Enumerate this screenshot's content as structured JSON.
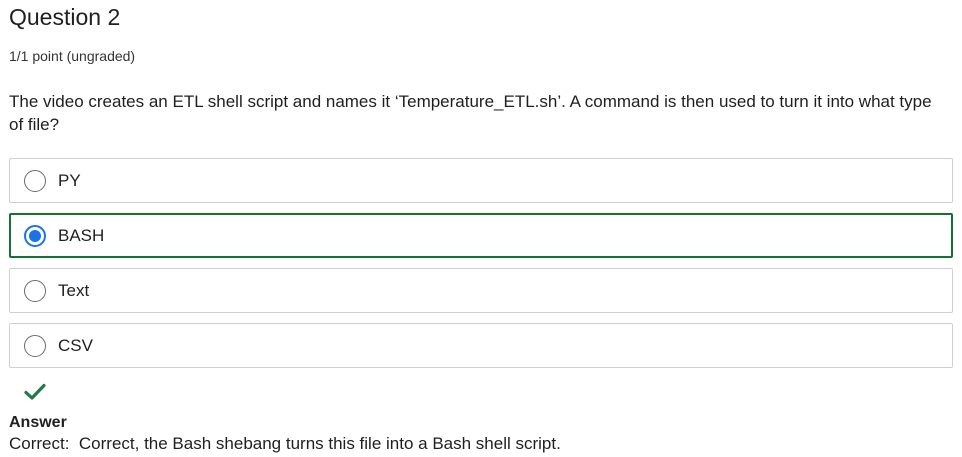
{
  "question": {
    "title": "Question 2",
    "points": "1/1 point (ungraded)",
    "prompt": "The video creates an ETL shell script and names it ‘Temperature_ETL.sh’. A command is then used to turn it into what type of file?"
  },
  "options": [
    {
      "label": "PY",
      "selected": false
    },
    {
      "label": "BASH",
      "selected": true
    },
    {
      "label": "Text",
      "selected": false
    },
    {
      "label": "CSV",
      "selected": false
    }
  ],
  "feedback": {
    "status_icon": "checkmark-icon",
    "heading": "Answer",
    "text": "Correct:  Correct, the Bash shebang turns this file into a Bash shell script."
  },
  "colors": {
    "selected_border": "#137333",
    "radio_selected": "#1a73e8",
    "check": "#1e7a46"
  }
}
